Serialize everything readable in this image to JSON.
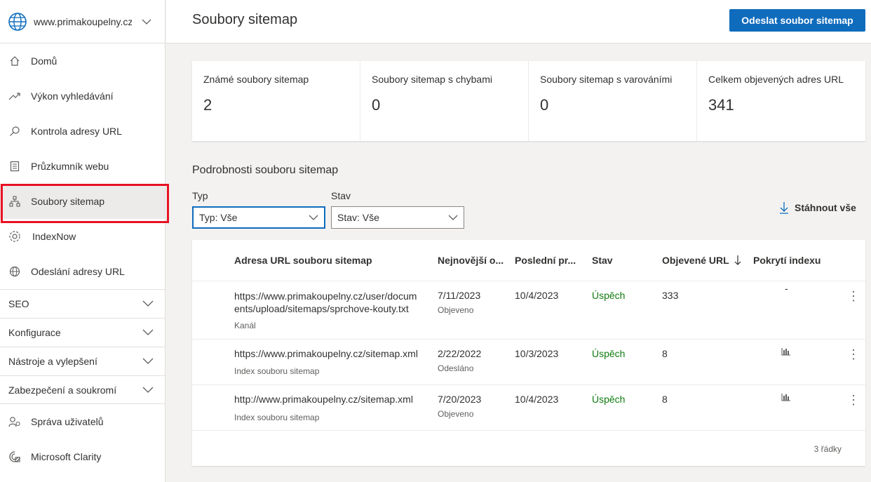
{
  "site": {
    "name": "www.primakoupelny.cz"
  },
  "nav": {
    "items": [
      {
        "label": "Domů"
      },
      {
        "label": "Výkon vyhledávání"
      },
      {
        "label": "Kontrola adresy URL"
      },
      {
        "label": "Průzkumník webu"
      },
      {
        "label": "Soubory sitemap"
      },
      {
        "label": "IndexNow"
      },
      {
        "label": "Odeslání adresy URL"
      }
    ],
    "groups": [
      {
        "label": "SEO"
      },
      {
        "label": "Konfigurace"
      },
      {
        "label": "Nástroje a vylepšení"
      },
      {
        "label": "Zabezpečení a soukromí"
      }
    ],
    "bottom_items": [
      {
        "label": "Správa uživatelů"
      },
      {
        "label": "Microsoft Clarity"
      }
    ]
  },
  "header": {
    "title": "Soubory sitemap",
    "submit_label": "Odeslat soubor sitemap"
  },
  "stats": [
    {
      "label": "Známé soubory sitemap",
      "value": "2"
    },
    {
      "label": "Soubory sitemap s chybami",
      "value": "0"
    },
    {
      "label": "Soubory sitemap s varováními",
      "value": "0"
    },
    {
      "label": "Celkem objevených adres URL",
      "value": "341"
    }
  ],
  "details": {
    "title": "Podrobnosti souboru sitemap",
    "type_label": "Typ",
    "type_value": "Typ: Vše",
    "status_label": "Stav",
    "status_value": "Stav: Vše",
    "download_label": "Stáhnout vše"
  },
  "table": {
    "columns": [
      "Adresa URL souboru sitemap",
      "Nejnovější o...",
      "Poslední pr...",
      "Stav",
      "Objevené URL",
      "Pokrytí indexu"
    ],
    "rows": [
      {
        "url_line1": "https://www.primakoupelny.cz/user/docum",
        "url_line2": "ents/upload/sitemaps/sprchove-kouty.txt",
        "type": "Kanál",
        "date": "7/11/2023",
        "date_note": "Objeveno",
        "last": "10/4/2023",
        "status": "Úspěch",
        "found": "333",
        "coverage": "-"
      },
      {
        "url_line1": "https://www.primakoupelny.cz/sitemap.xml",
        "url_line2": "",
        "type": "Index souboru sitemap",
        "date": "2/22/2022",
        "date_note": "Odesláno",
        "last": "10/3/2023",
        "status": "Úspěch",
        "found": "8",
        "coverage": ""
      },
      {
        "url_line1": "http://www.primakoupelny.cz/sitemap.xml",
        "url_line2": "",
        "type": "Index souboru sitemap",
        "date": "7/20/2023",
        "date_note": "Objeveno",
        "last": "10/4/2023",
        "status": "Úspěch",
        "found": "8",
        "coverage": ""
      }
    ],
    "row_count": "3 řádky"
  },
  "colors": {
    "accent": "#0f6cbd",
    "success": "#107c10",
    "highlight": "#e81123"
  },
  "icons": [
    "globe-icon",
    "home-icon",
    "trend-icon",
    "search-icon",
    "explorer-icon",
    "sitemap-icon",
    "gear-icon",
    "globe-small-icon",
    "users-icon",
    "clarity-icon",
    "download-icon",
    "bar-chart-icon",
    "more-icon"
  ]
}
